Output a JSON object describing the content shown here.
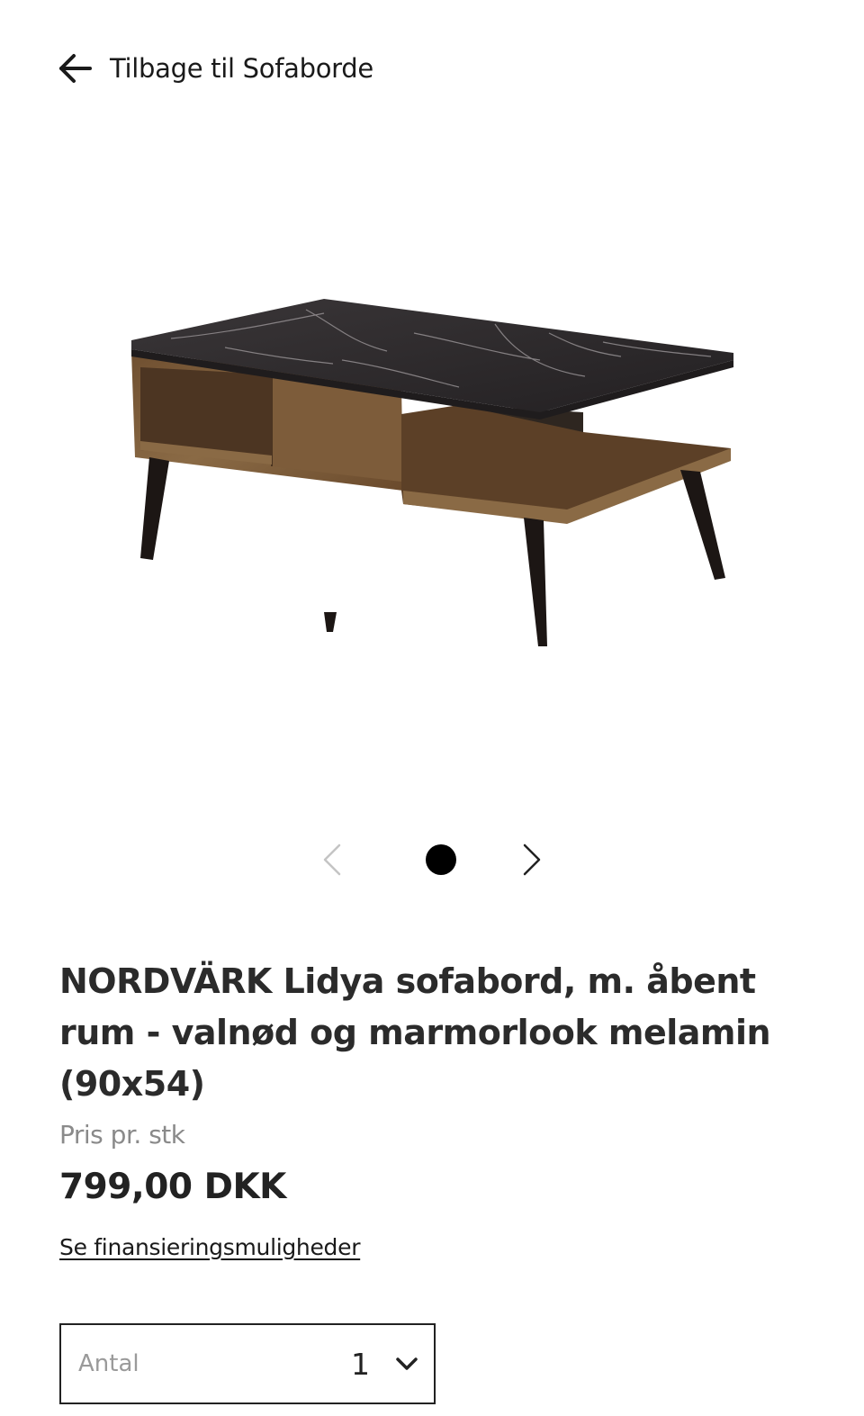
{
  "header": {
    "back_label": "Tilbage til Sofaborde"
  },
  "gallery": {
    "image_alt": "NORDVÄRK Lidya sofabord",
    "slide_count": 1,
    "current_slide": 1,
    "prev_icon": "chevron-left-icon",
    "next_icon": "chevron-right-icon"
  },
  "product": {
    "title": "NORDVÄRK Lidya sofabord, m. åbent rum - valnød og marmorlook melamin (90x54)",
    "price_label": "Pris pr. stk",
    "price": "799,00 DKK",
    "financing_link": "Se finansieringsmuligheder"
  },
  "quantity": {
    "label": "Antal",
    "value": "1"
  },
  "colors": {
    "text": "#222222",
    "muted": "#8a8a8a",
    "walnut": "#7a5a38",
    "marble": "#2e2b2d",
    "legs": "#1c1614"
  }
}
